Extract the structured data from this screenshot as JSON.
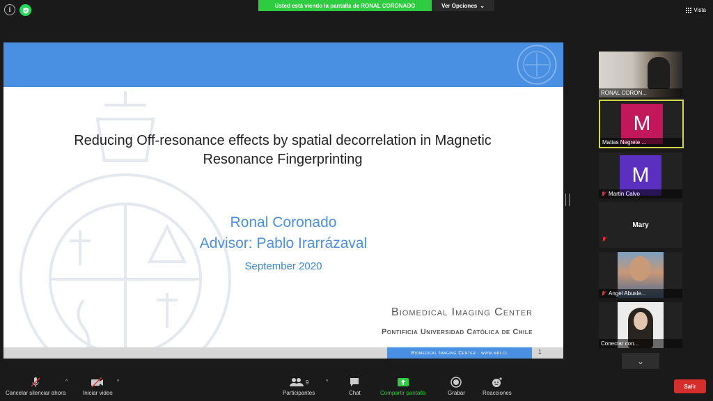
{
  "top": {
    "share_banner": "Usted está viendo la pantalla de  RONAL CORONADO",
    "view_options": "Ver Opciones",
    "view_label": "Vista"
  },
  "slide": {
    "title_line1": "Reducing Off-resonance effects by spatial decorrelation in Magnetic",
    "title_line2": "Resonance Fingerprinting",
    "author": "Ronal Coronado",
    "advisor": "Advisor: Pablo Irarrázaval",
    "date": "September 2020",
    "center_name": "Biomedical Imaging Center",
    "university": "Pontificia Universidad Católica de Chile",
    "footer_text": "Biomedical Imaging Center · www.mri.cl",
    "page_number": "1",
    "seal_text": "PONTIFICIA UNIVERSIDAD CATOLICA DE CHILE"
  },
  "participants": [
    {
      "name": "RONAL CORON...",
      "type": "video"
    },
    {
      "name": "Matias Negrete ...",
      "initial": "M",
      "color": "#c2185b",
      "active": true
    },
    {
      "name": "Martin Calvo",
      "initial": "M",
      "color": "#5b2fbf",
      "muted": true
    },
    {
      "name": "Mary",
      "muted": true
    },
    {
      "name": "Angel Abusle...",
      "muted": true,
      "type": "video"
    },
    {
      "name": "Conectar con...",
      "type": "video"
    }
  ],
  "toolbar": {
    "mute_label": "Cancelar silenciar ahora",
    "video_label": "Iniciar video",
    "participants_label": "Participantes",
    "participants_count": "9",
    "chat_label": "Chat",
    "share_label": "Compartir pantalla",
    "record_label": "Grabar",
    "reactions_label": "Reacciones",
    "leave_label": "Salir"
  },
  "colors": {
    "share_green": "#2ecc40",
    "slide_blue": "#4a90e2",
    "leave_red": "#d62d2d",
    "active_border": "#d4d94a"
  }
}
